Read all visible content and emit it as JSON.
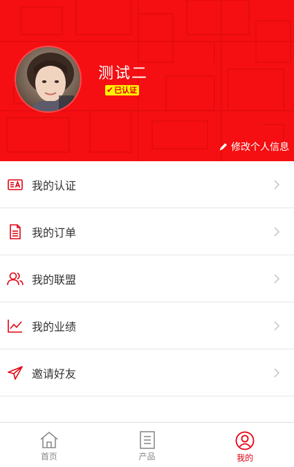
{
  "profile": {
    "name": "测试二",
    "verified_label": "已认证",
    "edit_label": "修改个人信息"
  },
  "menu": {
    "items": [
      {
        "label": "我的认证",
        "icon": "id-card-icon"
      },
      {
        "label": "我的订单",
        "icon": "document-icon"
      },
      {
        "label": "我的联盟",
        "icon": "users-icon"
      },
      {
        "label": "我的业绩",
        "icon": "trend-chart-icon"
      },
      {
        "label": "邀请好友",
        "icon": "send-icon"
      }
    ]
  },
  "tabbar": {
    "tabs": [
      {
        "label": "首页",
        "icon": "home-icon"
      },
      {
        "label": "产品",
        "icon": "product-list-icon"
      },
      {
        "label": "我的",
        "icon": "user-circle-icon",
        "active": true
      }
    ]
  },
  "colors": {
    "brand_red": "#f50f12",
    "badge_yellow": "#fff200",
    "icon_red": "#e3000f"
  }
}
